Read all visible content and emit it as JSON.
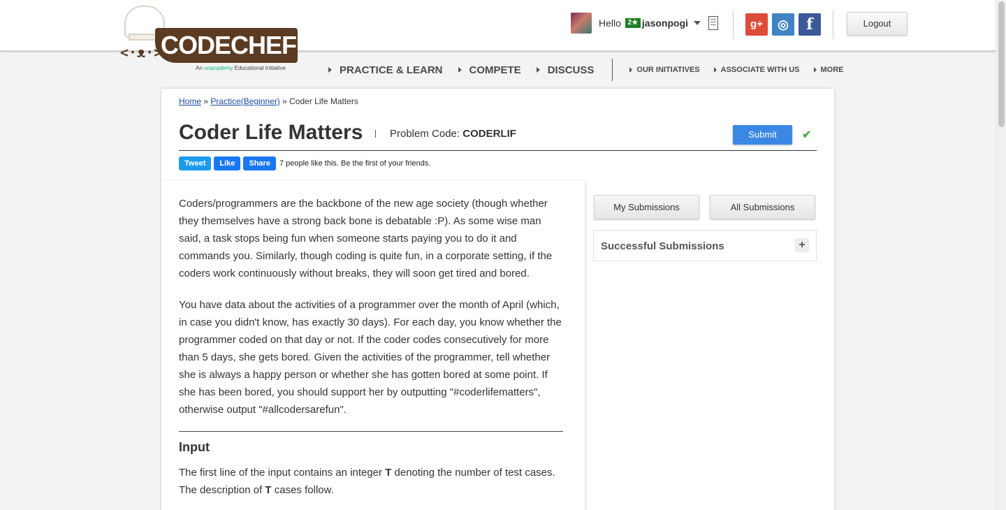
{
  "brand": {
    "logo_text": "CODECHEF",
    "logo_face": "<·ᴥ·>",
    "tagline_prefix": "An",
    "tagline_brand": "unacademy",
    "tagline_suffix": "Educational Initiative"
  },
  "user": {
    "greeting": "Hello",
    "rating_badge": "2★",
    "username": "jasonpogi"
  },
  "header": {
    "logout_label": "Logout",
    "social": {
      "google_plus": "g+",
      "github": "◎",
      "facebook": "f"
    }
  },
  "nav": {
    "primary": [
      "PRACTICE & LEARN",
      "COMPETE",
      "DISCUSS"
    ],
    "secondary": [
      "OUR INITIATIVES",
      "ASSOCIATE WITH US",
      "MORE"
    ]
  },
  "breadcrumb": {
    "home": "Home",
    "sep1": "»",
    "practice": "Practice(Beginner)",
    "sep2": "»",
    "current": "Coder Life Matters"
  },
  "problem": {
    "title": "Coder Life Matters",
    "code_label": "Problem Code:",
    "code_value": "CODERLIF",
    "submit_label": "Submit",
    "check_mark": "✔"
  },
  "share": {
    "tweet_label": "Tweet",
    "like_label": "Like",
    "share_label": "Share",
    "like_text": "7 people like this. Be the first of your friends."
  },
  "statement": {
    "para1": "Coders/programmers are the backbone of the new age society (though whether they themselves have a strong back bone is debatable :P). As some wise man said, a task stops being fun when someone starts paying you to do it and commands you. Similarly, though coding is quite fun, in a corporate setting, if the coders work continuously without breaks, they will soon get tired and bored.",
    "para2": "You have data about the activities of a programmer over the month of April (which, in case you didn't know, has exactly 30 days). For each day, you know whether the programmer coded on that day or not. If the coder codes consecutively for more than 5 days, she gets bored. Given the activities of the programmer, tell whether she is always a happy person or whether she has gotten bored at some point. If she has been bored, you should support her by outputting \"#coderlifematters\", otherwise output \"#allcodersarefun\".",
    "input_heading": "Input",
    "input_text_1": "The first line of the input contains an integer",
    "input_var_1": "T",
    "input_text_2": "denoting the number of test cases. The description of",
    "input_var_2": "T",
    "input_text_3": "cases follow."
  },
  "sidebar": {
    "my_submissions": "My Submissions",
    "all_submissions": "All Submissions",
    "successful_submissions": "Successful Submissions",
    "expand_symbol": "+"
  }
}
